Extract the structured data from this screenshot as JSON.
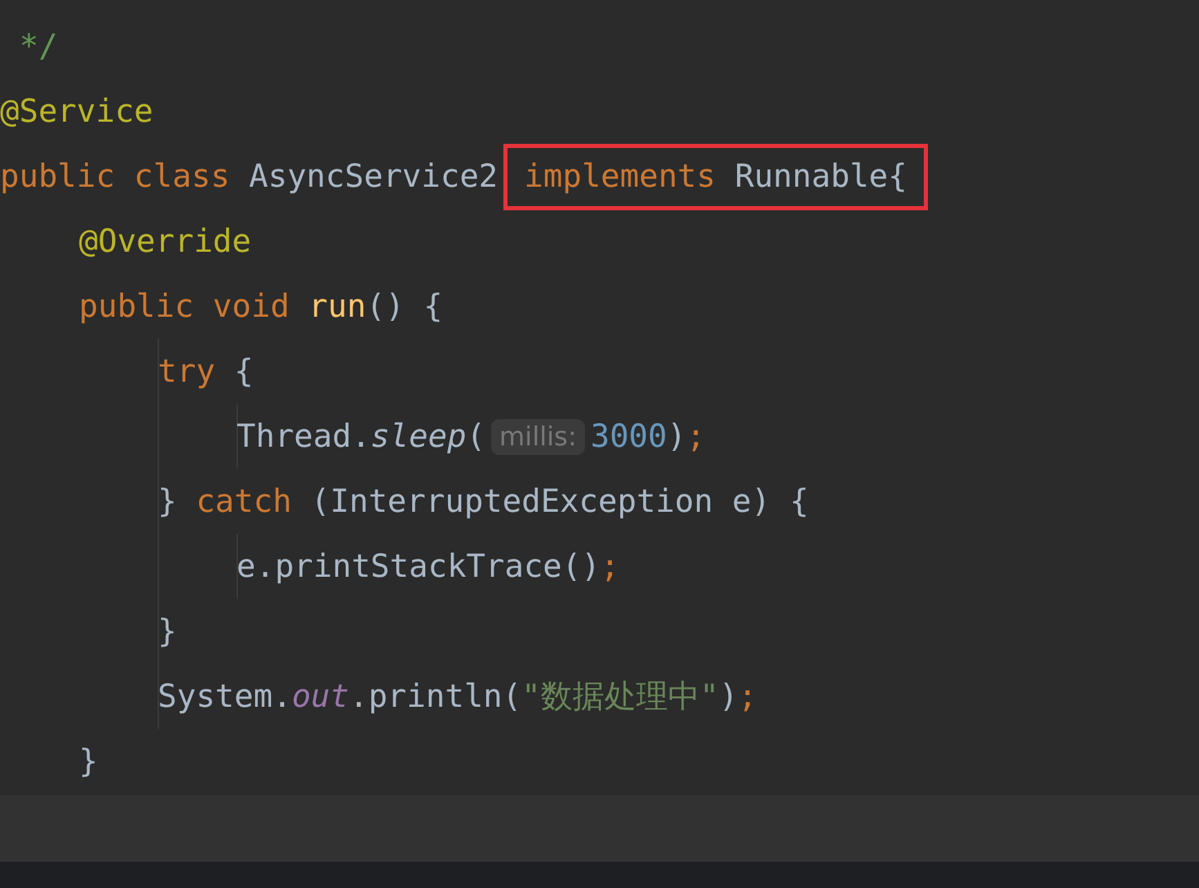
{
  "editor": {
    "lines": [
      {
        "tokens": [
          {
            "text": "*/",
            "kind": "comment"
          }
        ]
      },
      {
        "tokens": [
          {
            "text": "@Service",
            "kind": "annotation"
          }
        ]
      },
      {
        "tokens": [
          {
            "text": "public class ",
            "kind": "keyword"
          },
          {
            "text": "AsyncService2",
            "kind": "plain"
          }
        ],
        "boxed_tokens": [
          {
            "text": "implements ",
            "kind": "keyword"
          },
          {
            "text": "Runnable{",
            "kind": "plain"
          }
        ],
        "children": [
          {
            "tokens": [
              {
                "text": "@Override",
                "kind": "annotation"
              }
            ]
          },
          {
            "tokens": [
              {
                "text": "public void ",
                "kind": "keyword"
              },
              {
                "text": "run",
                "kind": "method"
              },
              {
                "text": "() {",
                "kind": "plain"
              }
            ],
            "children": [
              {
                "tokens": [
                  {
                    "text": "try ",
                    "kind": "keyword"
                  },
                  {
                    "text": "{",
                    "kind": "plain"
                  }
                ],
                "children": [
                  {
                    "tokens": [
                      {
                        "text": "Thread.",
                        "kind": "plain"
                      },
                      {
                        "text": "sleep",
                        "kind": "static-method"
                      },
                      {
                        "text": "(",
                        "kind": "plain"
                      },
                      {
                        "text": "millis:",
                        "kind": "hint"
                      },
                      {
                        "text": "3000",
                        "kind": "number"
                      },
                      {
                        "text": ")",
                        "kind": "plain"
                      },
                      {
                        "text": ";",
                        "kind": "punct"
                      }
                    ]
                  }
                ]
              },
              {
                "tokens": [
                  {
                    "text": "} ",
                    "kind": "plain"
                  },
                  {
                    "text": "catch ",
                    "kind": "keyword"
                  },
                  {
                    "text": "(InterruptedException e) {",
                    "kind": "plain"
                  }
                ],
                "children": [
                  {
                    "tokens": [
                      {
                        "text": "e.printStackTrace()",
                        "kind": "plain"
                      },
                      {
                        "text": ";",
                        "kind": "punct"
                      }
                    ]
                  }
                ]
              },
              {
                "tokens": [
                  {
                    "text": "}",
                    "kind": "plain"
                  }
                ]
              },
              {
                "tokens": [
                  {
                    "text": "System.",
                    "kind": "plain"
                  },
                  {
                    "text": "out",
                    "kind": "static-field"
                  },
                  {
                    "text": ".println(",
                    "kind": "plain"
                  },
                  {
                    "text": "\"数据处理中\"",
                    "kind": "string"
                  },
                  {
                    "text": ")",
                    "kind": "plain"
                  },
                  {
                    "text": ";",
                    "kind": "punct"
                  }
                ]
              }
            ]
          },
          {
            "tokens": [
              {
                "text": "}",
                "kind": "plain"
              }
            ]
          }
        ]
      }
    ]
  }
}
